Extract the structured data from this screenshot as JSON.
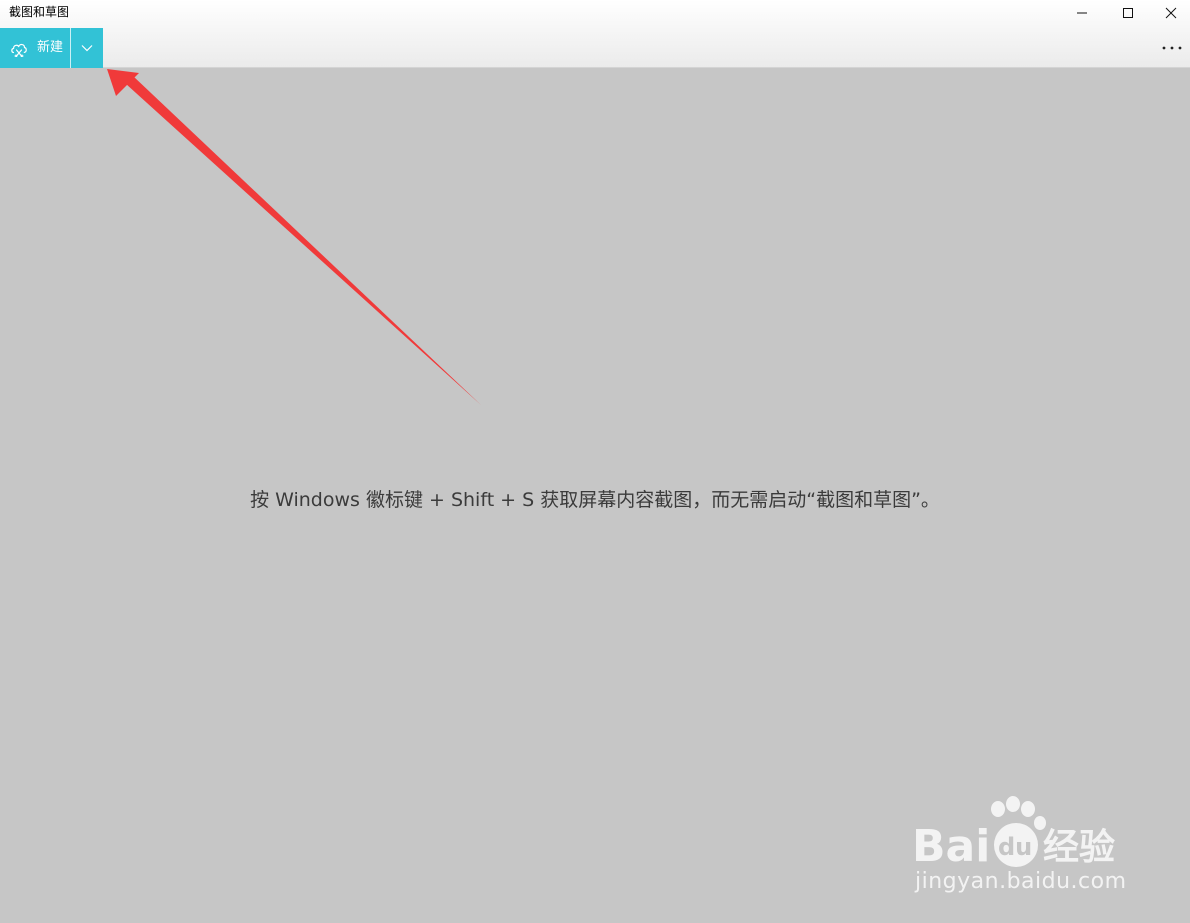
{
  "window": {
    "title": "截图和草图"
  },
  "toolbar": {
    "new_label": "新建",
    "new_icon": "snip-icon",
    "dropdown_icon": "chevron-down-icon",
    "more_icon": "more-icon",
    "accent_color": "#32c2d6"
  },
  "main": {
    "hint": "按 Windows 徽标键 + Shift + S 获取屏幕内容截图，而无需启动“截图和草图”。",
    "background_color": "#c6c6c6"
  },
  "annotation": {
    "arrow_color": "#f03a3a"
  },
  "watermark": {
    "brand": "Baidu经验",
    "url": "jingyan.baidu.com"
  }
}
